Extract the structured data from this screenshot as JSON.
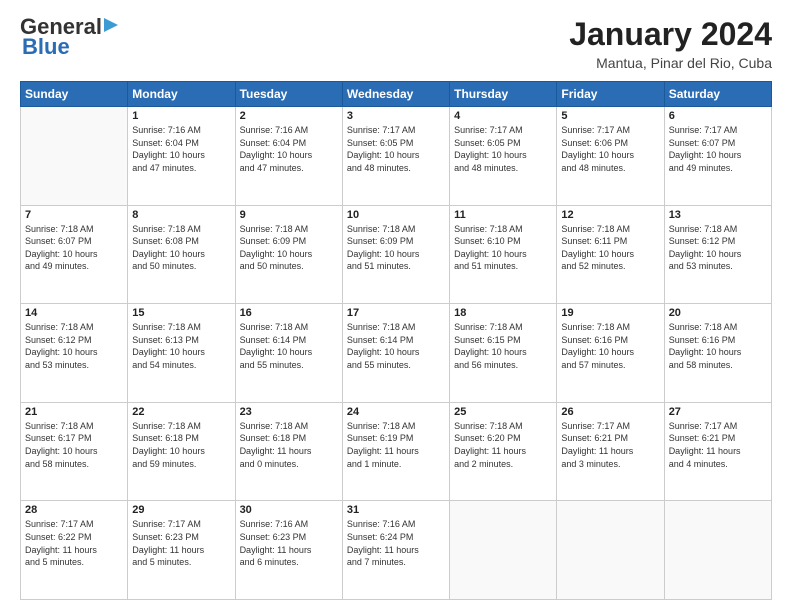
{
  "header": {
    "logo_line1": "General",
    "logo_line2": "Blue",
    "month_title": "January 2024",
    "subtitle": "Mantua, Pinar del Rio, Cuba"
  },
  "weekdays": [
    "Sunday",
    "Monday",
    "Tuesday",
    "Wednesday",
    "Thursday",
    "Friday",
    "Saturday"
  ],
  "weeks": [
    [
      {
        "num": "",
        "info": ""
      },
      {
        "num": "1",
        "info": "Sunrise: 7:16 AM\nSunset: 6:04 PM\nDaylight: 10 hours\nand 47 minutes."
      },
      {
        "num": "2",
        "info": "Sunrise: 7:16 AM\nSunset: 6:04 PM\nDaylight: 10 hours\nand 47 minutes."
      },
      {
        "num": "3",
        "info": "Sunrise: 7:17 AM\nSunset: 6:05 PM\nDaylight: 10 hours\nand 48 minutes."
      },
      {
        "num": "4",
        "info": "Sunrise: 7:17 AM\nSunset: 6:05 PM\nDaylight: 10 hours\nand 48 minutes."
      },
      {
        "num": "5",
        "info": "Sunrise: 7:17 AM\nSunset: 6:06 PM\nDaylight: 10 hours\nand 48 minutes."
      },
      {
        "num": "6",
        "info": "Sunrise: 7:17 AM\nSunset: 6:07 PM\nDaylight: 10 hours\nand 49 minutes."
      }
    ],
    [
      {
        "num": "7",
        "info": "Sunrise: 7:18 AM\nSunset: 6:07 PM\nDaylight: 10 hours\nand 49 minutes."
      },
      {
        "num": "8",
        "info": "Sunrise: 7:18 AM\nSunset: 6:08 PM\nDaylight: 10 hours\nand 50 minutes."
      },
      {
        "num": "9",
        "info": "Sunrise: 7:18 AM\nSunset: 6:09 PM\nDaylight: 10 hours\nand 50 minutes."
      },
      {
        "num": "10",
        "info": "Sunrise: 7:18 AM\nSunset: 6:09 PM\nDaylight: 10 hours\nand 51 minutes."
      },
      {
        "num": "11",
        "info": "Sunrise: 7:18 AM\nSunset: 6:10 PM\nDaylight: 10 hours\nand 51 minutes."
      },
      {
        "num": "12",
        "info": "Sunrise: 7:18 AM\nSunset: 6:11 PM\nDaylight: 10 hours\nand 52 minutes."
      },
      {
        "num": "13",
        "info": "Sunrise: 7:18 AM\nSunset: 6:12 PM\nDaylight: 10 hours\nand 53 minutes."
      }
    ],
    [
      {
        "num": "14",
        "info": "Sunrise: 7:18 AM\nSunset: 6:12 PM\nDaylight: 10 hours\nand 53 minutes."
      },
      {
        "num": "15",
        "info": "Sunrise: 7:18 AM\nSunset: 6:13 PM\nDaylight: 10 hours\nand 54 minutes."
      },
      {
        "num": "16",
        "info": "Sunrise: 7:18 AM\nSunset: 6:14 PM\nDaylight: 10 hours\nand 55 minutes."
      },
      {
        "num": "17",
        "info": "Sunrise: 7:18 AM\nSunset: 6:14 PM\nDaylight: 10 hours\nand 55 minutes."
      },
      {
        "num": "18",
        "info": "Sunrise: 7:18 AM\nSunset: 6:15 PM\nDaylight: 10 hours\nand 56 minutes."
      },
      {
        "num": "19",
        "info": "Sunrise: 7:18 AM\nSunset: 6:16 PM\nDaylight: 10 hours\nand 57 minutes."
      },
      {
        "num": "20",
        "info": "Sunrise: 7:18 AM\nSunset: 6:16 PM\nDaylight: 10 hours\nand 58 minutes."
      }
    ],
    [
      {
        "num": "21",
        "info": "Sunrise: 7:18 AM\nSunset: 6:17 PM\nDaylight: 10 hours\nand 58 minutes."
      },
      {
        "num": "22",
        "info": "Sunrise: 7:18 AM\nSunset: 6:18 PM\nDaylight: 10 hours\nand 59 minutes."
      },
      {
        "num": "23",
        "info": "Sunrise: 7:18 AM\nSunset: 6:18 PM\nDaylight: 11 hours\nand 0 minutes."
      },
      {
        "num": "24",
        "info": "Sunrise: 7:18 AM\nSunset: 6:19 PM\nDaylight: 11 hours\nand 1 minute."
      },
      {
        "num": "25",
        "info": "Sunrise: 7:18 AM\nSunset: 6:20 PM\nDaylight: 11 hours\nand 2 minutes."
      },
      {
        "num": "26",
        "info": "Sunrise: 7:17 AM\nSunset: 6:21 PM\nDaylight: 11 hours\nand 3 minutes."
      },
      {
        "num": "27",
        "info": "Sunrise: 7:17 AM\nSunset: 6:21 PM\nDaylight: 11 hours\nand 4 minutes."
      }
    ],
    [
      {
        "num": "28",
        "info": "Sunrise: 7:17 AM\nSunset: 6:22 PM\nDaylight: 11 hours\nand 5 minutes."
      },
      {
        "num": "29",
        "info": "Sunrise: 7:17 AM\nSunset: 6:23 PM\nDaylight: 11 hours\nand 5 minutes."
      },
      {
        "num": "30",
        "info": "Sunrise: 7:16 AM\nSunset: 6:23 PM\nDaylight: 11 hours\nand 6 minutes."
      },
      {
        "num": "31",
        "info": "Sunrise: 7:16 AM\nSunset: 6:24 PM\nDaylight: 11 hours\nand 7 minutes."
      },
      {
        "num": "",
        "info": ""
      },
      {
        "num": "",
        "info": ""
      },
      {
        "num": "",
        "info": ""
      }
    ]
  ]
}
